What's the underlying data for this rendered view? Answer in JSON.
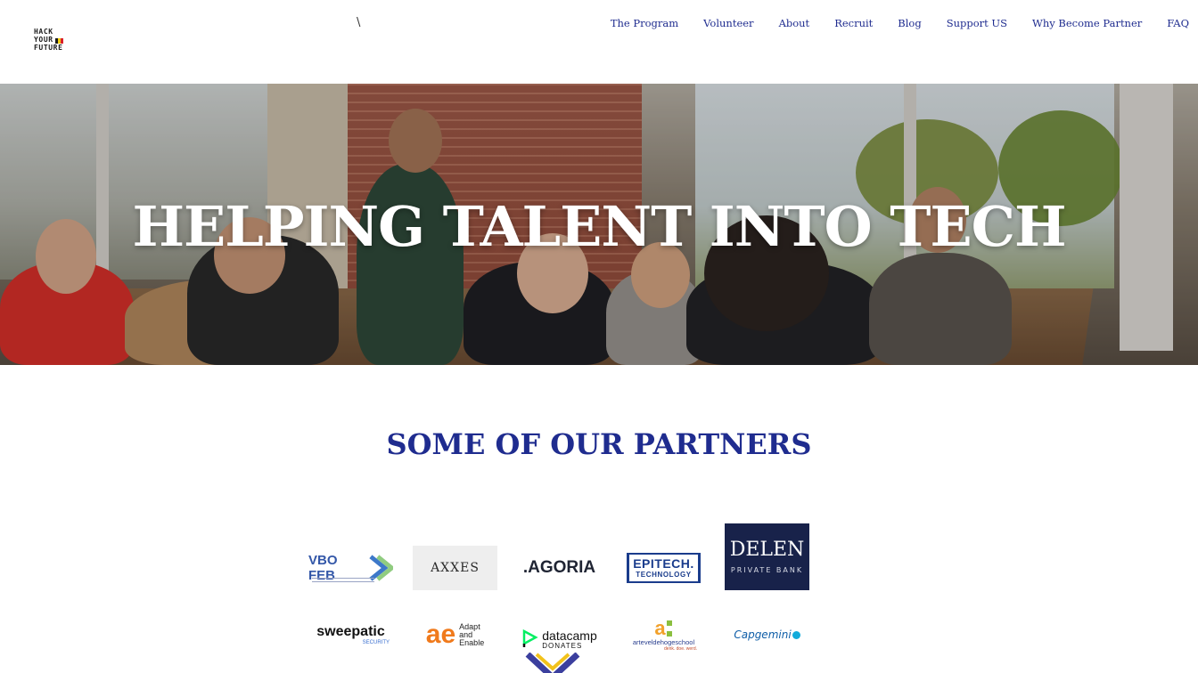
{
  "header": {
    "logo_lines": [
      "HACK",
      "YOUR",
      "FUTURE"
    ],
    "separator": "\\",
    "nav": [
      "The Program",
      "Volunteer",
      "About",
      "Recruit",
      "Blog",
      "Support US",
      "Why Become Partner",
      "FAQ"
    ]
  },
  "hero": {
    "title": "HELPING TALENT INTO TECH"
  },
  "partners": {
    "title": "SOME OF OUR PARTNERS",
    "vbo": "VBO FEB",
    "axxes": "AXXES",
    "agoria": ".AGORIA",
    "epitech_main": "EPITECH.",
    "epitech_sub": "TECHNOLOGY",
    "delen_main": "DELEN",
    "delen_sub": "PRIVATE BANK",
    "sweepatic_main": "sweepatic",
    "sweepatic_sub": "SECURITY",
    "ae_mark": "ae",
    "ae_lines": [
      "Adapt",
      "and",
      "Enable"
    ],
    "datacamp_main": "datacamp",
    "datacamp_sub": "DONATES",
    "artevelde_main": "arteveldehogeschool",
    "artevelde_sub": "denk. doe. werd.",
    "capgemini": "Capgemini"
  },
  "colors": {
    "nav_link": "#1f2c8f",
    "section_title": "#1f2c8f",
    "delen_bg": "#18224a",
    "flag": [
      "#1b1b1b",
      "#f5d010",
      "#d9202a"
    ]
  }
}
